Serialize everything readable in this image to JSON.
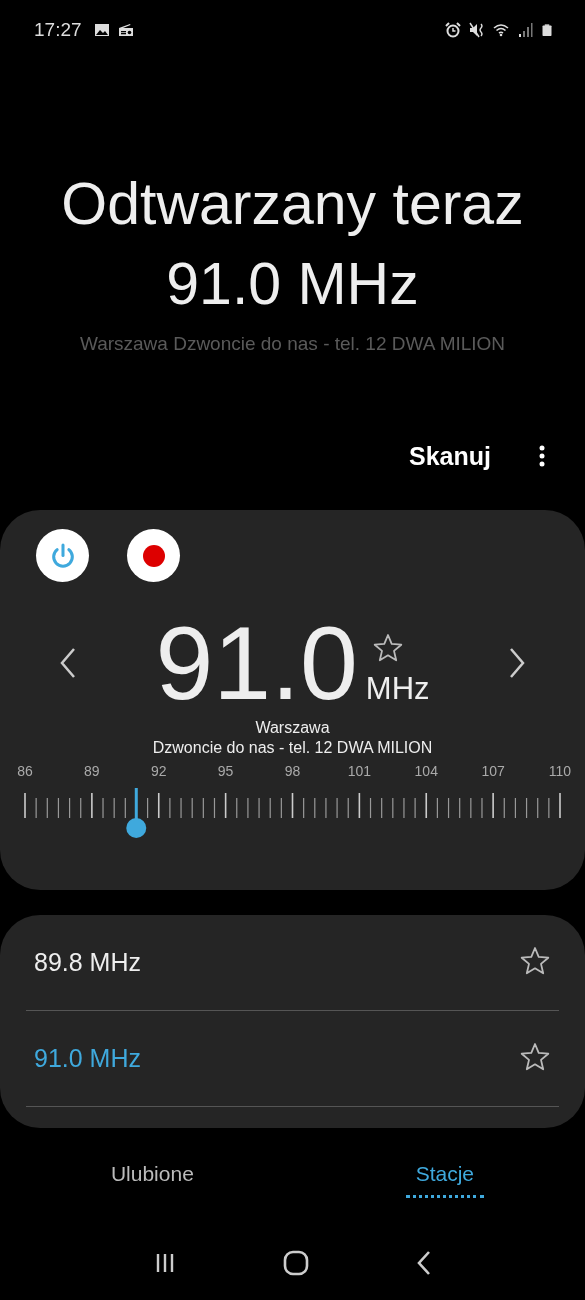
{
  "status_bar": {
    "time": "17:27"
  },
  "now_playing": {
    "title": "Odtwarzany teraz",
    "frequency": "91.0 MHz",
    "station_info": "Warszawa Dzwoncie do nas - tel. 12 DWA MILION"
  },
  "toolbar": {
    "scan": "Skanuj"
  },
  "tuner": {
    "power_on": true,
    "frequency": "91.0",
    "unit": "MHz",
    "favorite": false,
    "station": "Warszawa",
    "rds_text": "Dzwoncie do nas - tel. 12 DWA MILION",
    "scale_labels": [
      "86",
      "89",
      "92",
      "95",
      "98",
      "101",
      "104",
      "107",
      "110"
    ],
    "level": 0.208
  },
  "stations": [
    {
      "frequency": "89.8 MHz",
      "selected": false,
      "favorite": false
    },
    {
      "frequency": "91.0 MHz",
      "selected": true,
      "favorite": false
    }
  ],
  "tabs": [
    {
      "label": "Ulubione",
      "selected": false
    },
    {
      "label": "Stacje",
      "selected": true
    }
  ]
}
